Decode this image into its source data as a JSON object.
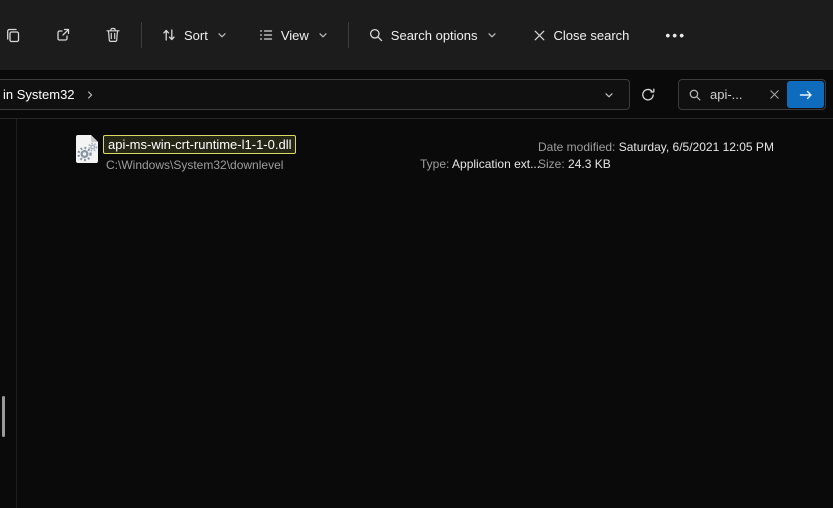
{
  "toolbar": {
    "sort": "Sort",
    "view": "View",
    "search_options": "Search options",
    "close_search": "Close search",
    "see_more": "•••"
  },
  "address": {
    "breadcrumb": "in System32"
  },
  "search": {
    "query": "api-..."
  },
  "file": {
    "name": "api-ms-win-crt-runtime-l1-1-0.dll",
    "path": "C:\\Windows\\System32\\downlevel",
    "type_label": "Type:",
    "type": "Application ext...",
    "date_label": "Date modified:",
    "date": "Saturday, 6/5/2021 12:05 PM",
    "size_label": "Size:",
    "size": "24.3 KB"
  },
  "icons": {
    "toolbar": [
      "copy-icon",
      "share-icon",
      "delete-icon",
      "sort-arrows-icon",
      "view-list-icon",
      "search-icon",
      "close-icon",
      "see-more-dots"
    ],
    "address_row": [
      "chevron-right-icon",
      "chevron-down-icon",
      "refresh-icon",
      "search-icon",
      "clear-icon",
      "go-arrow-icon"
    ],
    "file": [
      "dll-gears-file-icon"
    ]
  },
  "colors": {
    "accent": "#0f6cbd",
    "search_highlight": "#d9da63",
    "toolbar_bg": "#1c1c1c",
    "window_bg": "#0a0a0a"
  }
}
